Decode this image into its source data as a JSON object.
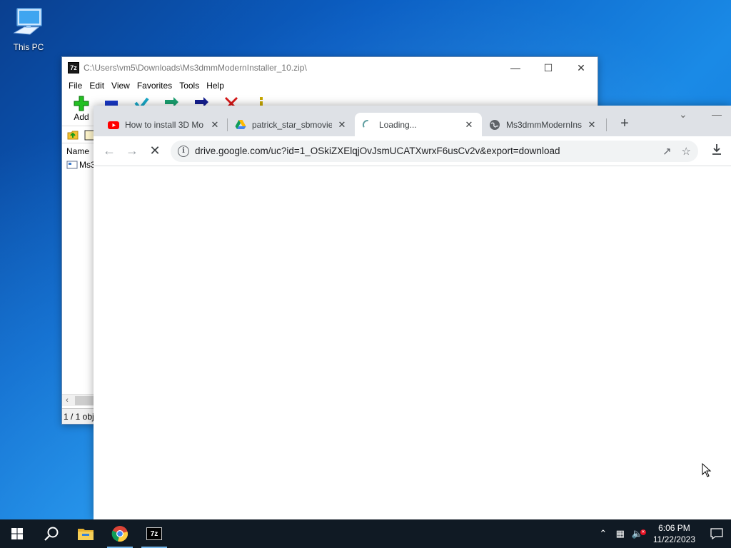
{
  "desktop": {
    "icons": [
      {
        "label": "This PC",
        "icon": "computer-icon"
      }
    ]
  },
  "zip_window": {
    "title": "C:\\Users\\vm5\\Downloads\\Ms3dmmModernInstaller_10.zip\\",
    "menu": [
      "File",
      "Edit",
      "View",
      "Favorites",
      "Tools",
      "Help"
    ],
    "toolbar": {
      "add_label": "Add"
    },
    "list_header": "Name",
    "row_name": "Ms3",
    "status": "1 / 1 obj"
  },
  "chrome": {
    "tabs": [
      {
        "title": "How to install 3D Mo",
        "icon": "youtube-icon"
      },
      {
        "title": "patrick_star_sbmovie",
        "icon": "google-drive-icon"
      },
      {
        "title": "Loading...",
        "icon": "loading-spinner-icon"
      },
      {
        "title": "Ms3dmmModernInst",
        "icon": "globe-icon"
      }
    ],
    "url": "drive.google.com/uc?id=1_OSkiZXElqjOvJsmUCATXwrxF6usCv2v&export=download"
  },
  "taskbar": {
    "time": "6:06 PM",
    "date": "11/22/2023",
    "pinned": [
      "start-icon",
      "search-icon",
      "file-explorer-icon",
      "chrome-icon",
      "7zip-icon"
    ],
    "zip_label": "7z"
  },
  "colors": {
    "chrome_accent": "#1a73e8",
    "taskbar_bg": "#101a24",
    "tabstrip_bg": "#dee1e6"
  }
}
